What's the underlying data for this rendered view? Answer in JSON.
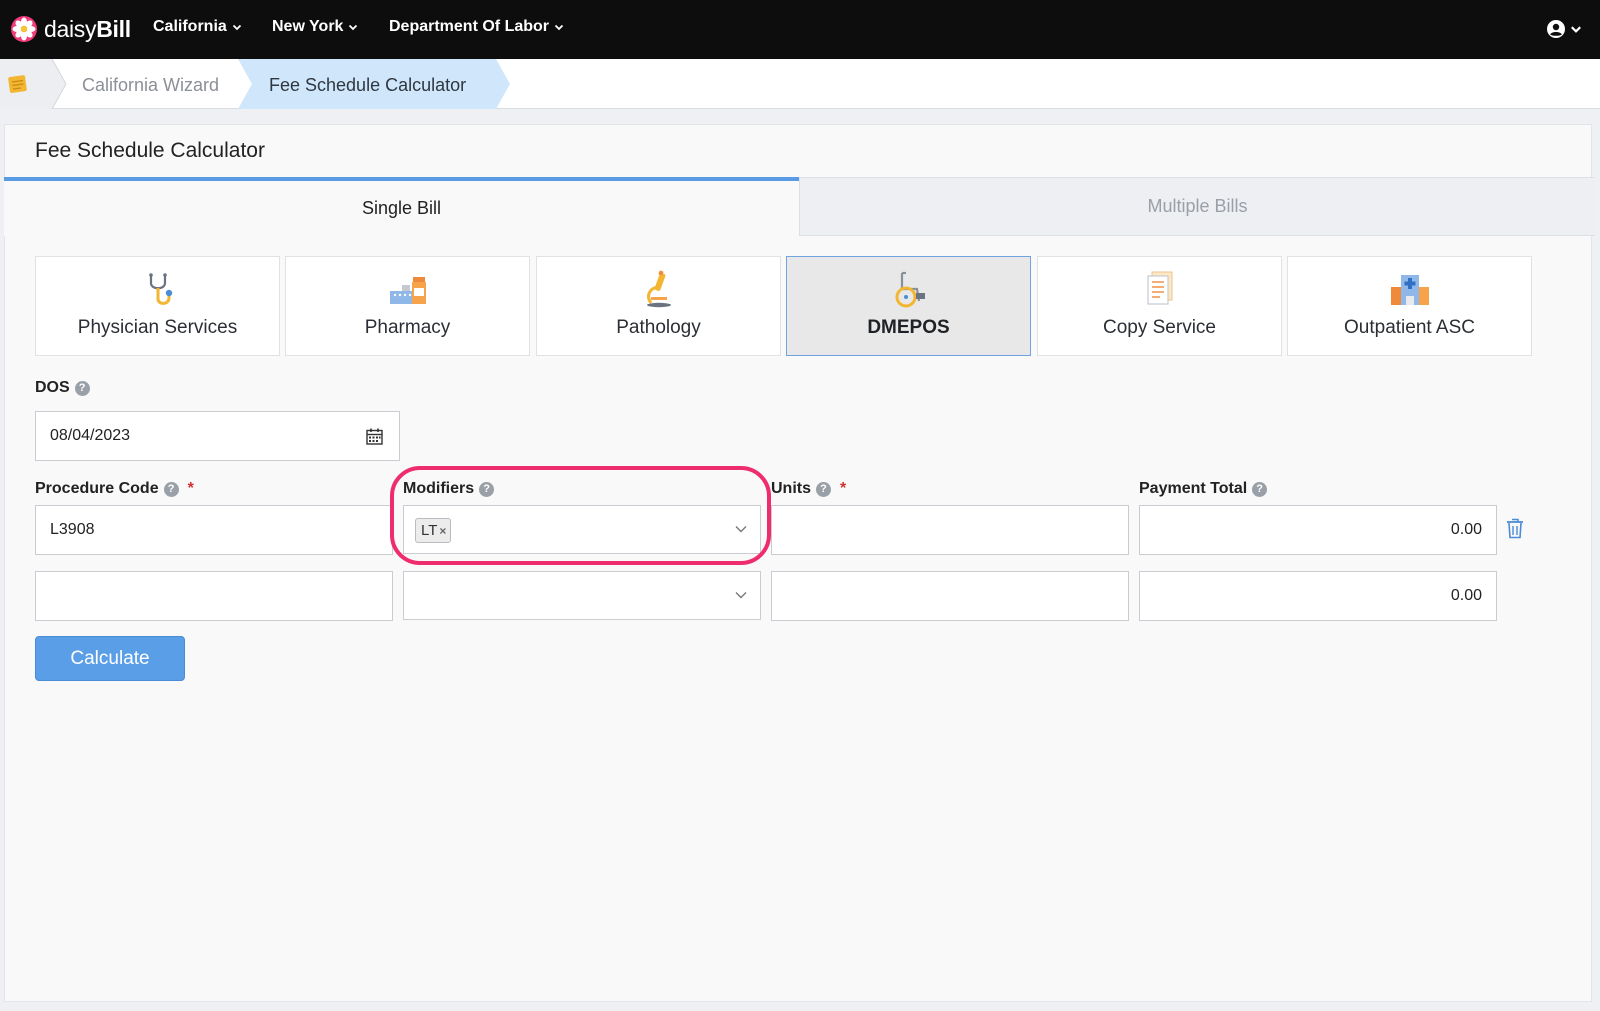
{
  "nav": {
    "logo_light": "daisy",
    "logo_bold": "Bill",
    "items": [
      {
        "label": "California",
        "icon": "chevron-down-icon"
      },
      {
        "label": "New York",
        "icon": "chevron-down-icon"
      },
      {
        "label": "Department Of Labor",
        "icon": "chevron-down-icon"
      }
    ],
    "user_icon": "user-circle-icon"
  },
  "breadcrumb": {
    "home_icon": "notepad-icon",
    "items": [
      "California Wizard",
      "Fee Schedule Calculator"
    ]
  },
  "panel": {
    "title": "Fee Schedule Calculator",
    "tabs": [
      {
        "label": "Single Bill",
        "active": true
      },
      {
        "label": "Multiple Bills",
        "active": false
      }
    ],
    "categories": [
      {
        "label": "Physician Services",
        "icon": "stethoscope-icon",
        "active": false
      },
      {
        "label": "Pharmacy",
        "icon": "pharmacy-icon",
        "active": false
      },
      {
        "label": "Pathology",
        "icon": "microscope-icon",
        "active": false
      },
      {
        "label": "DMEPOS",
        "icon": "wheelchair-icon",
        "active": true
      },
      {
        "label": "Copy Service",
        "icon": "document-icon",
        "active": false
      },
      {
        "label": "Outpatient ASC",
        "icon": "hospital-icon",
        "active": false
      }
    ]
  },
  "form": {
    "dos_label": "DOS",
    "dos_value": "08/04/2023",
    "procedure_label": "Procedure Code",
    "modifiers_label": "Modifiers",
    "units_label": "Units",
    "payment_label": "Payment Total",
    "required_mark": "*",
    "help_glyph": "?",
    "rows": [
      {
        "procedure": "L3908",
        "modifiers": [
          "LT"
        ],
        "units": "",
        "payment": "0.00"
      },
      {
        "procedure": "",
        "modifiers": [],
        "units": "",
        "payment": "0.00"
      }
    ],
    "chip_remove": "×",
    "calculate_label": "Calculate"
  },
  "colors": {
    "accent": "#5b9ee8",
    "highlight": "#ee2d6e",
    "required": "#d0312d",
    "nav_bg": "#0d0d0d"
  }
}
